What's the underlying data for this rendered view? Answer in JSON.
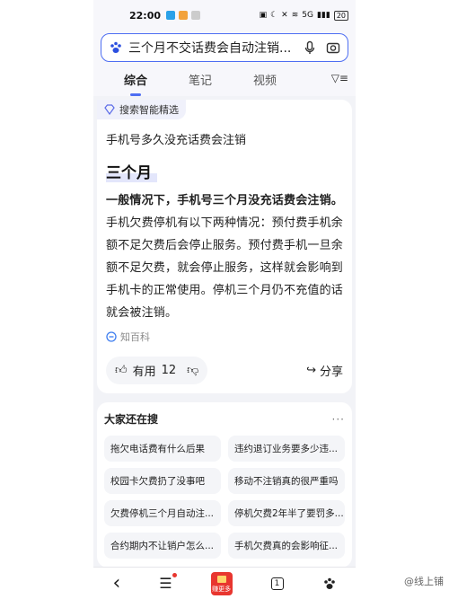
{
  "status_bar": {
    "time": "22:00",
    "signal_text": "5G",
    "battery": "20"
  },
  "search": {
    "query": "三个月不交话费会自动注销..."
  },
  "tabs": [
    {
      "label": "综合",
      "active": true
    },
    {
      "label": "笔记",
      "active": false
    },
    {
      "label": "视频",
      "active": false
    }
  ],
  "card": {
    "badge": "搜索智能精选",
    "title": "手机号多久没充话费会注销",
    "answer_head": "三个月",
    "answer_bold": "一般情况下，手机号三个月没充话费会注销。",
    "answer_rest": "手机欠费停机有以下两种情况：预付费手机余额不足欠费后会停止服务。预付费手机一旦余额不足欠费，就会停止服务，这样就会影响到手机卡的正常使用。停机三个月仍不充值的话就会被注销。",
    "source": "知百科",
    "like_label": "有用",
    "like_count": "12",
    "share_label": "分享"
  },
  "related": {
    "title": "大家还在搜",
    "more": "···",
    "items": [
      "拖欠电话费有什么后果",
      "违约退订业务要多少违...",
      "校园卡欠费扔了没事吧",
      "移动不注销真的很严重吗",
      "欠费停机三个月自动注...",
      "停机欠费2年半了要罚多...",
      "合约期内不让销户怎么...",
      "手机欠费真的会影响征..."
    ]
  },
  "bottom_nav": {
    "back": "‹",
    "menu": "☰",
    "red_label": "赚更多",
    "tab_count": "1"
  },
  "watermark": "@线上铺",
  "colors": {
    "accent": "#4e6ef2",
    "red": "#e8362f"
  }
}
